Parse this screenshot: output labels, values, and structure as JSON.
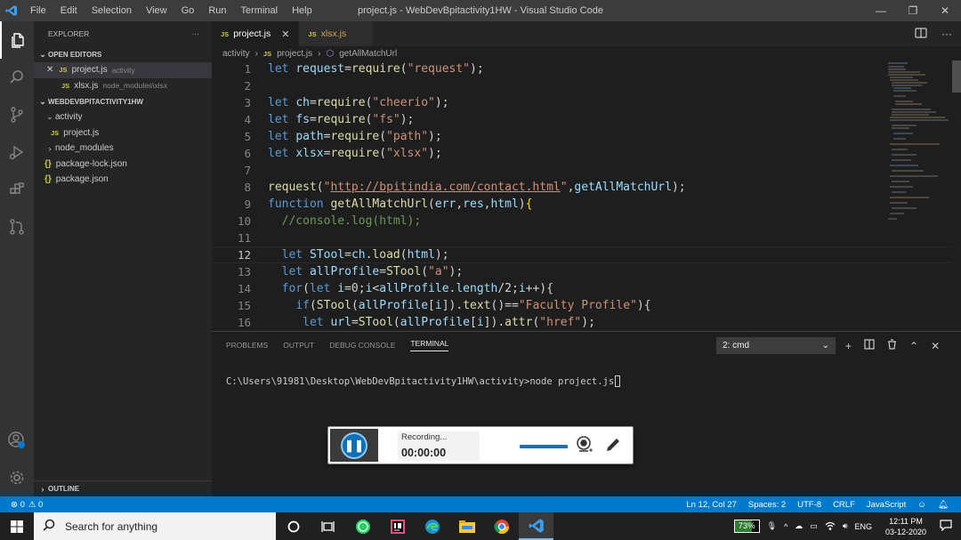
{
  "window": {
    "title": "project.js - WebDevBpitactivity1HW - Visual Studio Code",
    "menu": [
      "File",
      "Edit",
      "Selection",
      "View",
      "Go",
      "Run",
      "Terminal",
      "Help"
    ],
    "controls": [
      "—",
      "❐",
      "✕"
    ]
  },
  "sidebar": {
    "header": "EXPLORER",
    "more": "···",
    "open_editors_label": "OPEN EDITORS",
    "open_editors": [
      {
        "close": "✕",
        "badge": "JS",
        "name": "project.js",
        "path": "activity"
      },
      {
        "badge": "JS",
        "name": "xlsx.js",
        "path": "node_modules\\xlsx"
      }
    ],
    "workspace_label": "WEBDEVBPITACTIVITY1HW",
    "tree": [
      {
        "chev": "⌄",
        "name": "activity"
      },
      {
        "badge": "JS",
        "name": "project.js"
      },
      {
        "chev": "›",
        "name": "node_modules"
      },
      {
        "badge": "{}",
        "name": "package-lock.json"
      },
      {
        "badge": "{}",
        "name": "package.json"
      }
    ],
    "outline_label": "OUTLINE"
  },
  "tabs": [
    {
      "badge": "JS",
      "label": "project.js",
      "close": "✕"
    },
    {
      "badge": "JS",
      "label": "xlsx.js"
    }
  ],
  "breadcrumb": [
    "activity",
    "›",
    "JS",
    "project.js",
    "›",
    "getAllMatchUrl"
  ],
  "editor": {
    "line_numbers": [
      "1",
      "2",
      "3",
      "4",
      "5",
      "6",
      "7",
      "8",
      "9",
      "10",
      "11",
      "12",
      "13",
      "14",
      "15",
      "16"
    ]
  },
  "panel": {
    "tabs": [
      "PROBLEMS",
      "OUTPUT",
      "DEBUG CONSOLE",
      "TERMINAL"
    ],
    "terminal_select": "2: cmd",
    "prompt": "C:\\Users\\91981\\Desktop\\WebDevBpitactivity1HW\\activity>node project.js"
  },
  "recorder": {
    "status": "Recording...",
    "time": "00:00:00"
  },
  "statusbar": {
    "errors": "⊗ 0",
    "warnings": "⚠ 0",
    "position": "Ln 12, Col 27",
    "spaces": "Spaces: 2",
    "encoding": "UTF-8",
    "eol": "CRLF",
    "language": "JavaScript"
  },
  "taskbar": {
    "search_placeholder": "Search for anything",
    "battery": "73%",
    "battery_level": 0.73,
    "lang": "ENG",
    "time": "12:11 PM",
    "date": "03-12-2020"
  },
  "colors": {
    "accent": "#007acc",
    "keyword": "#569cd6",
    "string": "#ce9178",
    "function": "#dcdcaa",
    "variable": "#9cdcfe",
    "comment": "#6a9955"
  }
}
